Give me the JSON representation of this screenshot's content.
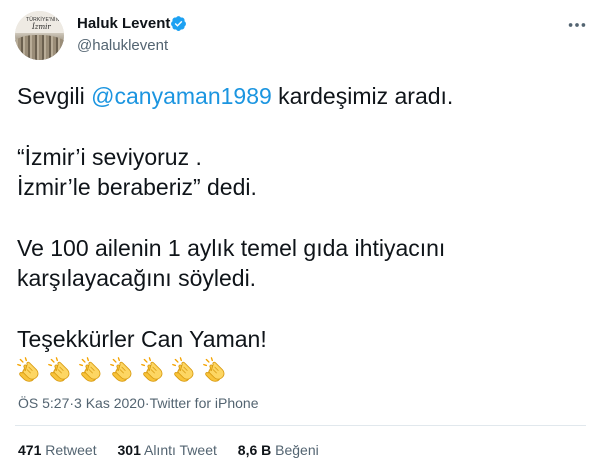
{
  "author": {
    "name": "Haluk Levent",
    "handle": "@haluklevent",
    "avatar_banner": "TÜRKİYE'NİN",
    "avatar_city": "İzmir"
  },
  "tweet": {
    "line1_prefix": "Sevgili ",
    "line1_mention": "@canyaman1989",
    "line1_suffix": " kardeşimiz aradı.",
    "line2": "“İzmir’i seviyoruz .",
    "line3": "İzmir’le beraberiz” dedi.",
    "line4": "Ve 100 ailenin 1 aylık temel gıda ihtiyacını",
    "line5": "karşılayacağını söyledi.",
    "line6": "Teşekkürler Can Yaman!",
    "clap_icon": "clapping-hands-icon",
    "clap_count": 7
  },
  "meta": {
    "time": "ÖS 5:27",
    "sep1": " · ",
    "date": "3 Kas 2020",
    "sep2": " · ",
    "source": "Twitter for iPhone"
  },
  "stats": {
    "retweets_count": "471",
    "retweets_label": "Retweet",
    "quotes_count": "301",
    "quotes_label": "Alıntı Tweet",
    "likes_count": "8,6 B",
    "likes_label": "Beğeni"
  },
  "colors": {
    "text": "#0f1419",
    "muted": "#536471",
    "link": "#1b95e0",
    "verified": "#1da1f2",
    "divider": "#e1e8ed"
  }
}
